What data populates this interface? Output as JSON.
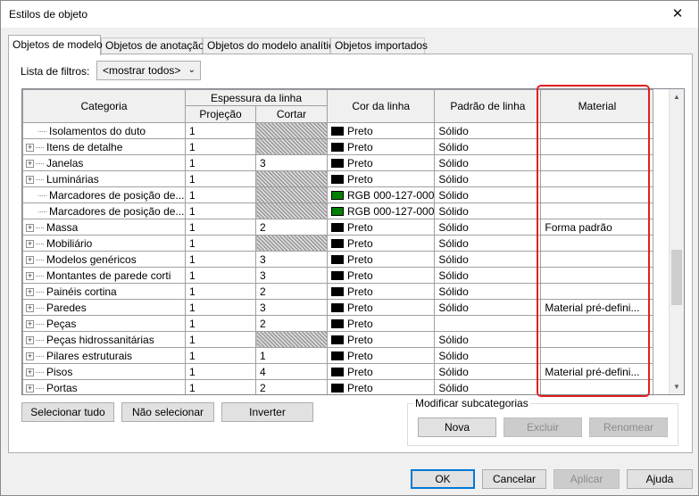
{
  "window": {
    "title": "Estilos de objeto",
    "close_glyph": "✕"
  },
  "tabs": [
    {
      "label": "Objetos de modelo",
      "active": true
    },
    {
      "label": "Objetos de anotação",
      "active": false
    },
    {
      "label": "Objetos do modelo analítico",
      "active": false
    },
    {
      "label": "Objetos importados",
      "active": false
    }
  ],
  "filter": {
    "label": "Lista de filtros:",
    "value": "<mostrar todos>"
  },
  "table": {
    "headers": {
      "category": "Categoria",
      "line_weight": "Espessura da linha",
      "projection": "Projeção",
      "cut": "Cortar",
      "line_color": "Cor da linha",
      "line_pattern": "Padrão de linha",
      "material": "Material"
    },
    "rows": [
      {
        "expand": false,
        "category": "Isolamentos do duto",
        "projection": "1",
        "cut": "",
        "cut_hatched": true,
        "color_name": "Preto",
        "color": "#000000",
        "pattern": "Sólido",
        "material": ""
      },
      {
        "expand": true,
        "category": "Itens de detalhe",
        "projection": "1",
        "cut": "",
        "cut_hatched": true,
        "color_name": "Preto",
        "color": "#000000",
        "pattern": "Sólido",
        "material": ""
      },
      {
        "expand": true,
        "category": "Janelas",
        "projection": "1",
        "cut": "3",
        "cut_hatched": false,
        "color_name": "Preto",
        "color": "#000000",
        "pattern": "Sólido",
        "material": ""
      },
      {
        "expand": true,
        "category": "Luminárias",
        "projection": "1",
        "cut": "",
        "cut_hatched": true,
        "color_name": "Preto",
        "color": "#000000",
        "pattern": "Sólido",
        "material": ""
      },
      {
        "expand": false,
        "category": "Marcadores de posição de...",
        "projection": "1",
        "cut": "",
        "cut_hatched": true,
        "color_name": "RGB 000-127-000",
        "color": "#007f00",
        "pattern": "Sólido",
        "material": ""
      },
      {
        "expand": false,
        "category": "Marcadores de posição de...",
        "projection": "1",
        "cut": "",
        "cut_hatched": true,
        "color_name": "RGB 000-127-000",
        "color": "#007f00",
        "pattern": "Sólido",
        "material": ""
      },
      {
        "expand": true,
        "category": "Massa",
        "projection": "1",
        "cut": "2",
        "cut_hatched": false,
        "color_name": "Preto",
        "color": "#000000",
        "pattern": "Sólido",
        "material": "Forma padrão"
      },
      {
        "expand": true,
        "category": "Mobiliário",
        "projection": "1",
        "cut": "",
        "cut_hatched": true,
        "color_name": "Preto",
        "color": "#000000",
        "pattern": "Sólido",
        "material": ""
      },
      {
        "expand": true,
        "category": "Modelos genéricos",
        "projection": "1",
        "cut": "3",
        "cut_hatched": false,
        "color_name": "Preto",
        "color": "#000000",
        "pattern": "Sólido",
        "material": ""
      },
      {
        "expand": true,
        "category": "Montantes de parede corti",
        "projection": "1",
        "cut": "3",
        "cut_hatched": false,
        "color_name": "Preto",
        "color": "#000000",
        "pattern": "Sólido",
        "material": ""
      },
      {
        "expand": true,
        "category": "Painéis cortina",
        "projection": "1",
        "cut": "2",
        "cut_hatched": false,
        "color_name": "Preto",
        "color": "#000000",
        "pattern": "Sólido",
        "material": ""
      },
      {
        "expand": true,
        "category": "Paredes",
        "projection": "1",
        "cut": "3",
        "cut_hatched": false,
        "color_name": "Preto",
        "color": "#000000",
        "pattern": "Sólido",
        "material": "Material pré-defini..."
      },
      {
        "expand": true,
        "category": "Peças",
        "projection": "1",
        "cut": "2",
        "cut_hatched": false,
        "color_name": "Preto",
        "color": "#000000",
        "pattern": "",
        "material": ""
      },
      {
        "expand": true,
        "category": "Peças hidrossanitárias",
        "projection": "1",
        "cut": "",
        "cut_hatched": true,
        "color_name": "Preto",
        "color": "#000000",
        "pattern": "Sólido",
        "material": ""
      },
      {
        "expand": true,
        "category": "Pilares estruturais",
        "projection": "1",
        "cut": "1",
        "cut_hatched": false,
        "color_name": "Preto",
        "color": "#000000",
        "pattern": "Sólido",
        "material": ""
      },
      {
        "expand": true,
        "category": "Pisos",
        "projection": "1",
        "cut": "4",
        "cut_hatched": false,
        "color_name": "Preto",
        "color": "#000000",
        "pattern": "Sólido",
        "material": "Material pré-defini..."
      },
      {
        "expand": true,
        "category": "Portas",
        "projection": "1",
        "cut": "2",
        "cut_hatched": false,
        "color_name": "Preto",
        "color": "#000000",
        "pattern": "Sólido",
        "material": ""
      }
    ]
  },
  "actions": {
    "select_all": "Selecionar tudo",
    "select_none": "Não selecionar",
    "invert": "Inverter"
  },
  "subcategories": {
    "label": "Modificar subcategorias",
    "new": "Nova",
    "delete": "Excluir",
    "rename": "Renomear"
  },
  "footer": {
    "ok": "OK",
    "cancel": "Cancelar",
    "apply": "Aplicar",
    "help": "Ajuda"
  },
  "colors": {
    "highlight": "#e01f1f",
    "dark_green": "#007f00",
    "accent": "#0078d7"
  }
}
